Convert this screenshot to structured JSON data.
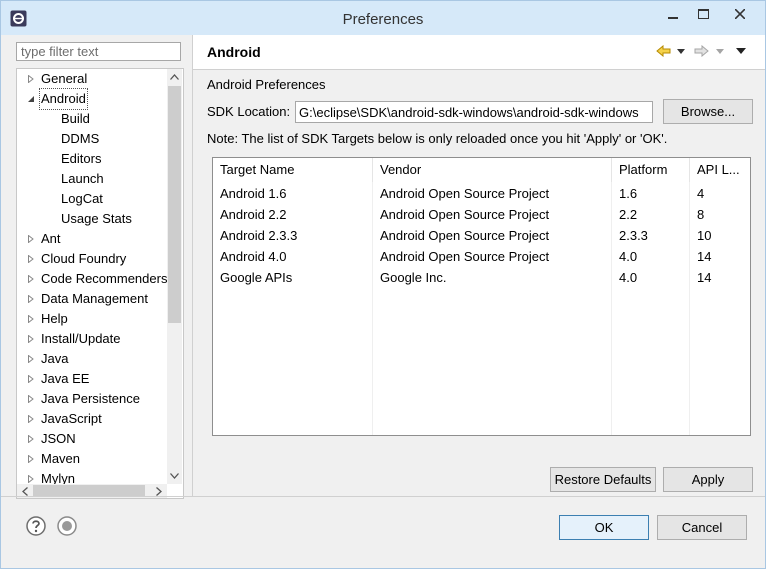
{
  "window": {
    "title": "Preferences"
  },
  "filter": {
    "placeholder": "type filter text"
  },
  "tree": {
    "items": [
      {
        "label": "General",
        "expanded": false
      },
      {
        "label": "Android",
        "expanded": true,
        "selected": true,
        "children": [
          "Build",
          "DDMS",
          "Editors",
          "Launch",
          "LogCat",
          "Usage Stats"
        ]
      },
      {
        "label": "Ant"
      },
      {
        "label": "Cloud Foundry"
      },
      {
        "label": "Code Recommenders"
      },
      {
        "label": "Data Management"
      },
      {
        "label": "Help"
      },
      {
        "label": "Install/Update"
      },
      {
        "label": "Java"
      },
      {
        "label": "Java EE"
      },
      {
        "label": "Java Persistence"
      },
      {
        "label": "JavaScript"
      },
      {
        "label": "JSON"
      },
      {
        "label": "Maven"
      },
      {
        "label": "Mylyn"
      }
    ]
  },
  "page": {
    "title": "Android",
    "section_label": "Android Preferences",
    "sdk_label": "SDK Location:",
    "sdk_value": "G:\\eclipse\\SDK\\android-sdk-windows\\android-sdk-windows",
    "browse_label": "Browse...",
    "note": "Note: The list of SDK Targets below is only reloaded once you hit 'Apply' or 'OK'."
  },
  "targets": {
    "columns": [
      "Target Name",
      "Vendor",
      "Platform",
      "API L..."
    ],
    "rows": [
      [
        "Android 1.6",
        "Android Open Source Project",
        "1.6",
        "4"
      ],
      [
        "Android 2.2",
        "Android Open Source Project",
        "2.2",
        "8"
      ],
      [
        "Android 2.3.3",
        "Android Open Source Project",
        "2.3.3",
        "10"
      ],
      [
        "Android 4.0",
        "Android Open Source Project",
        "4.0",
        "14"
      ],
      [
        "Google APIs",
        "Google Inc.",
        "4.0",
        "14"
      ]
    ]
  },
  "buttons": {
    "restore_defaults": "Restore Defaults",
    "apply": "Apply",
    "ok": "OK",
    "cancel": "Cancel"
  },
  "icons": {
    "app": "eclipse-icon",
    "back": "back-arrow-icon",
    "forward": "forward-arrow-icon",
    "menu": "view-menu-icon",
    "help": "help-icon",
    "import_export": "import-export-icon"
  },
  "colors": {
    "titlebar": "#d6e9f9",
    "back_arrow": "#e8b400",
    "selection_default_button": "#3c7fb1"
  }
}
